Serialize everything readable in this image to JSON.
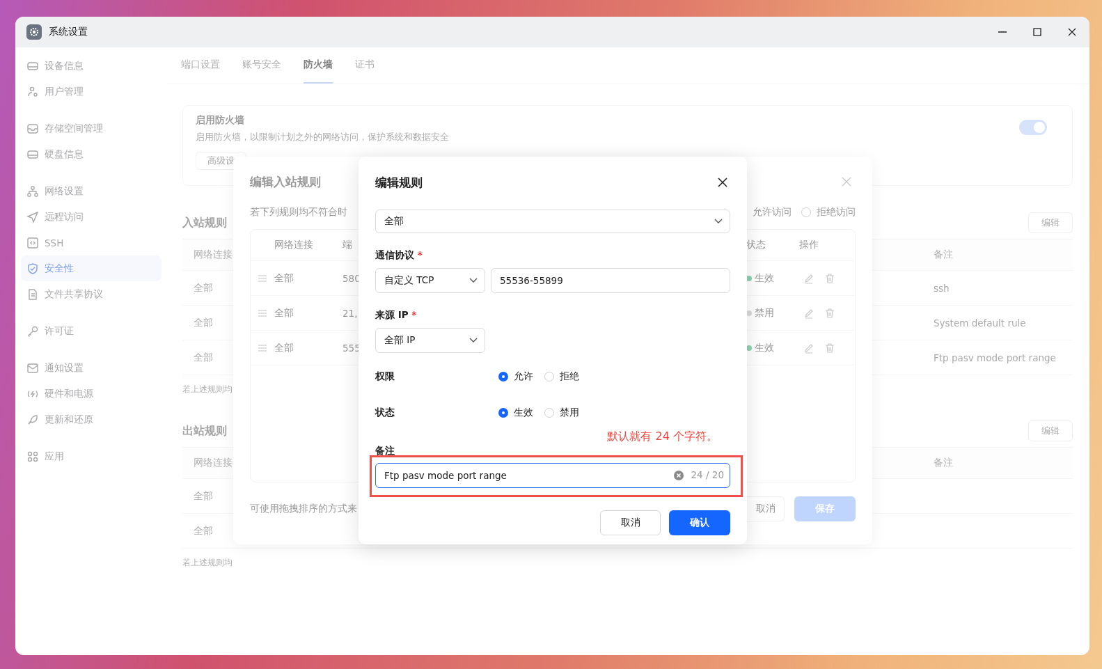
{
  "window": {
    "title": "系统设置"
  },
  "sidebar": {
    "groups": [
      {
        "items": [
          {
            "label": "设备信息",
            "selected": false
          },
          {
            "label": "用户管理",
            "selected": false
          }
        ]
      },
      {
        "items": [
          {
            "label": "存储空间管理",
            "selected": false
          },
          {
            "label": "硬盘信息",
            "selected": false
          }
        ]
      },
      {
        "items": [
          {
            "label": "网络设置",
            "selected": false
          },
          {
            "label": "远程访问",
            "selected": false
          },
          {
            "label": "SSH",
            "selected": false
          },
          {
            "label": "安全性",
            "selected": true
          },
          {
            "label": "文件共享协议",
            "selected": false
          }
        ]
      },
      {
        "items": [
          {
            "label": "许可证",
            "selected": false
          }
        ]
      },
      {
        "items": [
          {
            "label": "通知设置",
            "selected": false
          },
          {
            "label": "硬件和电源",
            "selected": false
          },
          {
            "label": "更新和还原",
            "selected": false
          }
        ]
      },
      {
        "items": [
          {
            "label": "应用",
            "selected": false
          }
        ]
      }
    ]
  },
  "tabs": [
    {
      "label": "端口设置",
      "selected": false
    },
    {
      "label": "账号安全",
      "selected": false
    },
    {
      "label": "防火墙",
      "selected": true
    },
    {
      "label": "证书",
      "selected": false
    }
  ],
  "firewall": {
    "title": "启用防火墙",
    "description": "启用防火墙，以限制计划之外的网络访问，保护系统和数据安全",
    "on": true,
    "advanced_button": "高级设"
  },
  "inbound_rules": {
    "title": "入站规则",
    "edit_button": "编辑",
    "columns": [
      "网络连接",
      "备注"
    ],
    "rows": [
      {
        "network": "全部",
        "note": "ssh"
      },
      {
        "network": "全部",
        "note": "System default rule"
      },
      {
        "network": "全部",
        "note": "Ftp pasv mode port range"
      }
    ],
    "footer": "若上述规则均"
  },
  "outbound_rules": {
    "title": "出站规则",
    "edit_button": "编辑",
    "columns": [
      "网络连接",
      "备注"
    ],
    "rows": [
      {
        "network": "全部"
      },
      {
        "network": "全部"
      }
    ],
    "footer": "若上述规则均"
  },
  "inbound_dialog": {
    "title": "编辑入站规则",
    "default_label": "若下列规则均不符合时",
    "default_options": [
      {
        "label": "允许访问"
      },
      {
        "label": "拒绝访问",
        "selected": false
      }
    ],
    "columns": [
      "网络连接",
      "端",
      "状态",
      "操作"
    ],
    "rows": [
      {
        "network": "全部",
        "port": "580",
        "status": "生效",
        "color": "#8fd1b2"
      },
      {
        "network": "全部",
        "port": "21,",
        "status": "禁用",
        "color": "#d9d9d9"
      },
      {
        "network": "全部",
        "port": "555",
        "status": "生效",
        "color": "#8fd1b2"
      }
    ],
    "hint": "可使用拖拽排序的方式来",
    "cancel_button": "取消",
    "save_button": {
      "label": "保存",
      "disabled": true
    }
  },
  "edit_dialog": {
    "title": "编辑规则",
    "network_select": "全部",
    "protocol": {
      "label": "通信协议",
      "required_mark": "*",
      "value": "自定义 TCP",
      "port": "55536-55899"
    },
    "source_ip": {
      "label": "来源 IP",
      "required_mark": "*",
      "value": "全部 IP"
    },
    "permission": {
      "label": "权限",
      "options": [
        {
          "label": "允许",
          "selected": true
        },
        {
          "label": "拒绝",
          "selected": false
        }
      ]
    },
    "status": {
      "label": "状态",
      "options": [
        {
          "label": "生效",
          "selected": true
        },
        {
          "label": "禁用",
          "selected": false
        }
      ]
    },
    "note": {
      "label": "备注",
      "value": "Ftp pasv mode port range",
      "counter": "24 / 20"
    },
    "cancel_button": "取消",
    "confirm_button": "确认"
  },
  "annotation": {
    "text": "默认就有 24 个字符。"
  }
}
